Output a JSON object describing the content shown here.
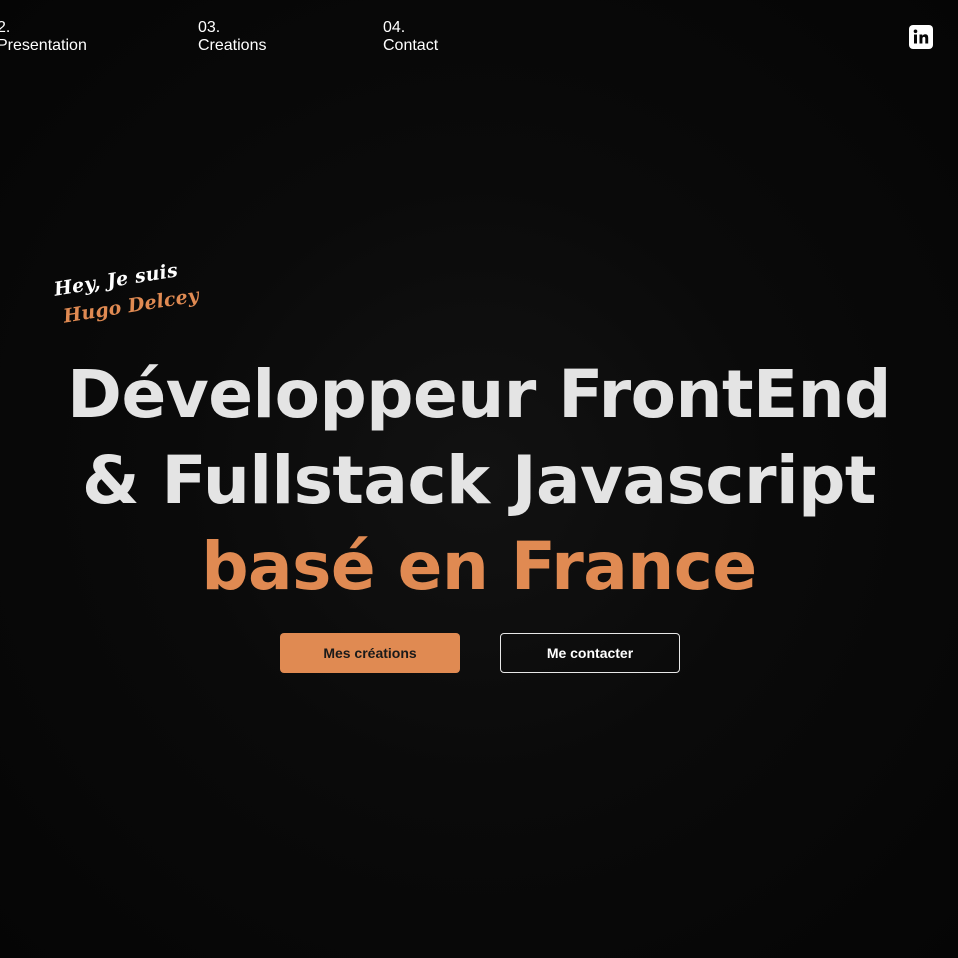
{
  "nav": {
    "items": [
      {
        "number": "2.",
        "label": "Presentation"
      },
      {
        "number": "03.",
        "label": "Creations"
      },
      {
        "number": "04.",
        "label": "Contact"
      }
    ]
  },
  "social": {
    "icon": "linkedin-icon"
  },
  "hero": {
    "greeting_line1": "Hey, Je suis",
    "greeting_line2": "Hugo Delcey",
    "headline_line1": "Développeur FrontEnd",
    "headline_line2": "& Fullstack Javascript",
    "headline_line3": "basé en France"
  },
  "buttons": {
    "primary_label": "Mes créations",
    "secondary_label": "Me contacter"
  },
  "colors": {
    "accent": "#e08a52",
    "background": "#060606",
    "text": "#e4e4e4"
  }
}
